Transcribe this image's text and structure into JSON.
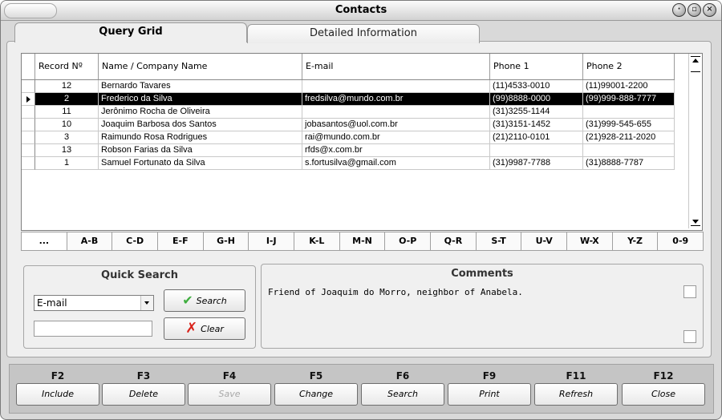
{
  "window": {
    "title": "Contacts"
  },
  "tabs": [
    {
      "label": "Query Grid"
    },
    {
      "label": "Detailed Information"
    }
  ],
  "grid": {
    "headers": [
      "Record Nº",
      "Name / Company Name",
      "E-mail",
      "Phone 1",
      "Phone 2"
    ],
    "rows": [
      [
        "12",
        "Bernardo Tavares",
        "",
        "(11)4533-0010",
        "(11)99001-2200"
      ],
      [
        "2",
        "Frederico da Silva",
        "fredsilva@mundo.com.br",
        "(99)8888-0000",
        "(99)999-888-7777"
      ],
      [
        "11",
        "Jerônimo Rocha de Oliveira",
        "",
        "(31)3255-1144",
        ""
      ],
      [
        "10",
        "Joaquim Barbosa dos Santos",
        "jobasantos@uol.com.br",
        "(31)3151-1452",
        "(31)999-545-655"
      ],
      [
        "3",
        "Raimundo Rosa Rodrigues",
        "rai@mundo.com.br",
        "(21)2110-0101",
        "(21)928-211-2020"
      ],
      [
        "13",
        "Robson Farias da Silva",
        "rfds@x.com.br",
        "",
        ""
      ],
      [
        "1",
        "Samuel Fortunato da Silva",
        "s.fortusilva@gmail.com",
        "(31)9987-7788",
        "(31)8888-7787"
      ]
    ],
    "selected_index": 1
  },
  "letters": [
    "...",
    "A-B",
    "C-D",
    "E-F",
    "G-H",
    "I-J",
    "K-L",
    "M-N",
    "O-P",
    "Q-R",
    "S-T",
    "U-V",
    "W-X",
    "Y-Z",
    "0-9"
  ],
  "quick_search": {
    "title": "Quick Search",
    "field_value": "E-mail",
    "search_label": "Search",
    "clear_label": "Clear"
  },
  "comments": {
    "title": "Comments",
    "text": "Friend of Joaquim do Morro, neighbor of Anabela."
  },
  "function_keys": [
    {
      "key": "F2",
      "label": "Include",
      "enabled": true
    },
    {
      "key": "F3",
      "label": "Delete",
      "enabled": true
    },
    {
      "key": "F4",
      "label": "Save",
      "enabled": false
    },
    {
      "key": "F5",
      "label": "Change",
      "enabled": true
    },
    {
      "key": "F6",
      "label": "Search",
      "enabled": true
    },
    {
      "key": "F9",
      "label": "Print",
      "enabled": true
    },
    {
      "key": "F11",
      "label": "Refresh",
      "enabled": true
    },
    {
      "key": "F12",
      "label": "Close",
      "enabled": true
    }
  ]
}
